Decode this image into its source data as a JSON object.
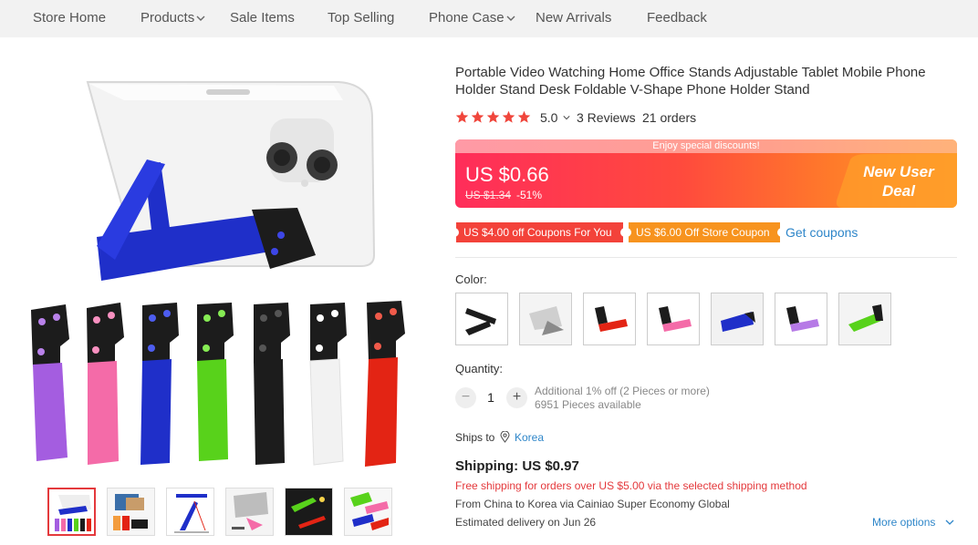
{
  "nav": {
    "items": [
      {
        "label": "Store Home",
        "dropdown": false
      },
      {
        "label": "Products",
        "dropdown": true
      },
      {
        "label": "Sale Items",
        "dropdown": false
      },
      {
        "label": "Top Selling",
        "dropdown": false
      },
      {
        "label": "Phone Case",
        "dropdown": true
      },
      {
        "label": "New Arrivals",
        "dropdown": false
      },
      {
        "label": "Feedback",
        "dropdown": false
      }
    ]
  },
  "gallery": {
    "stand_colors": [
      "#a45de0",
      "#f46ba8",
      "#1f2fc9",
      "#58d21b",
      "#1c1c1c",
      "#f2f2f2",
      "#e32414"
    ],
    "thumbnails": [
      {
        "icon": "stand-family-thumbnail",
        "active": true
      },
      {
        "icon": "stand-lifestyle-thumbnail",
        "active": false
      },
      {
        "icon": "stand-dimensions-thumbnail",
        "active": false
      },
      {
        "icon": "stand-tablet-thumbnail",
        "active": false
      },
      {
        "icon": "stand-dark-thumbnail",
        "active": false
      },
      {
        "icon": "stand-assorted-thumbnail",
        "active": false
      }
    ]
  },
  "product": {
    "title": "Portable Video Watching Home Office Stands Adjustable Tablet Mobile Phone Holder Stand Desk Foldable V-Shape Phone Holder Stand",
    "rating": "5.0",
    "stars_filled": 5,
    "reviews": "3 Reviews",
    "orders": "21 orders"
  },
  "price": {
    "banner_text": "Enjoy special discounts!",
    "current": "US $0.66",
    "original": "US $1.34",
    "discount": "-51%",
    "deal_line1": "New User",
    "deal_line2": "Deal"
  },
  "coupons": {
    "items": [
      {
        "label": "US $4.00 off Coupons For You",
        "color": "#f3423a"
      },
      {
        "label": "US $6.00 Off Store Coupon",
        "color": "#f7931e"
      }
    ],
    "get_link": "Get coupons"
  },
  "color": {
    "label": "Color:",
    "swatches": [
      {
        "name": "black",
        "color": "#1c1c1c"
      },
      {
        "name": "white",
        "color": "#f0f0f0"
      },
      {
        "name": "red",
        "color": "#e32414"
      },
      {
        "name": "pink",
        "color": "#f46ba8"
      },
      {
        "name": "blue",
        "color": "#1f2fc9"
      },
      {
        "name": "purple",
        "color": "#b67ae6"
      },
      {
        "name": "green",
        "color": "#58d21b"
      }
    ]
  },
  "quantity": {
    "label": "Quantity:",
    "value": "1",
    "minus": "−",
    "plus": "+",
    "note1": "Additional 1% off (2 Pieces or more)",
    "note2": "6951 Pieces available"
  },
  "shipping": {
    "ships_to_label": "Ships to",
    "country": "Korea",
    "price": "Shipping: US $0.97",
    "free_note": "Free shipping for orders over US $5.00 via the selected shipping method",
    "route": "From China to Korea via Cainiao Super Economy Global",
    "delivery": "Estimated delivery on Jun 26",
    "more_options": "More options"
  }
}
